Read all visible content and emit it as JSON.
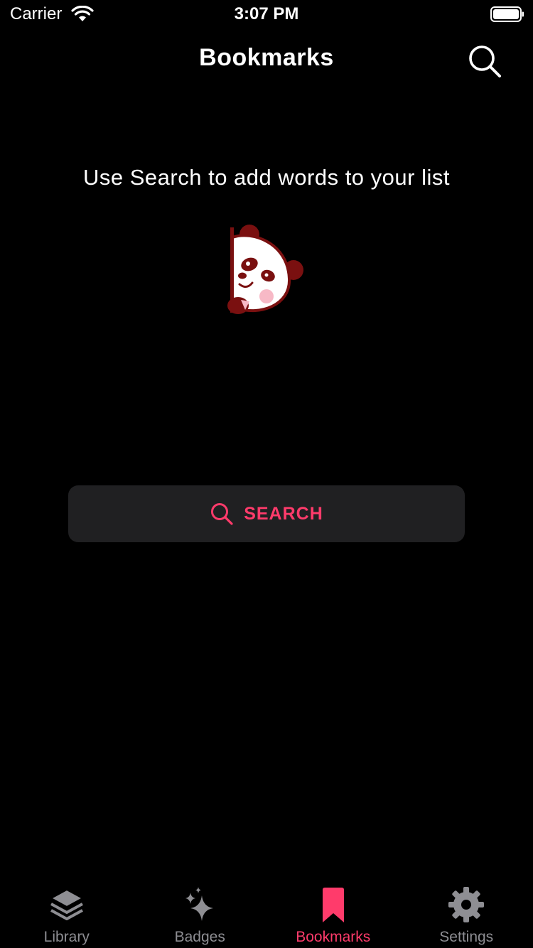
{
  "status_bar": {
    "carrier": "Carrier",
    "time": "3:07 PM",
    "icons": [
      "wifi-icon",
      "battery-icon"
    ]
  },
  "nav": {
    "title": "Bookmarks",
    "search_icon": "search-icon"
  },
  "empty_state": {
    "message": "Use Search to add words to your list",
    "illustration": "panda-peeking-illustration"
  },
  "search_button": {
    "label": "SEARCH",
    "icon": "search-icon"
  },
  "tab_bar": {
    "tabs": [
      {
        "label": "Library",
        "icon": "stack-layers-icon",
        "active": false
      },
      {
        "label": "Badges",
        "icon": "sparkle-icon",
        "active": false
      },
      {
        "label": "Bookmarks",
        "icon": "bookmark-icon",
        "active": true
      },
      {
        "label": "Settings",
        "icon": "gear-icon",
        "active": false
      }
    ]
  },
  "colors": {
    "background": "#000000",
    "accent": "#ff3b6b",
    "button_background": "#202022",
    "inactive_tab": "#8e8e93",
    "text": "#ffffff"
  }
}
